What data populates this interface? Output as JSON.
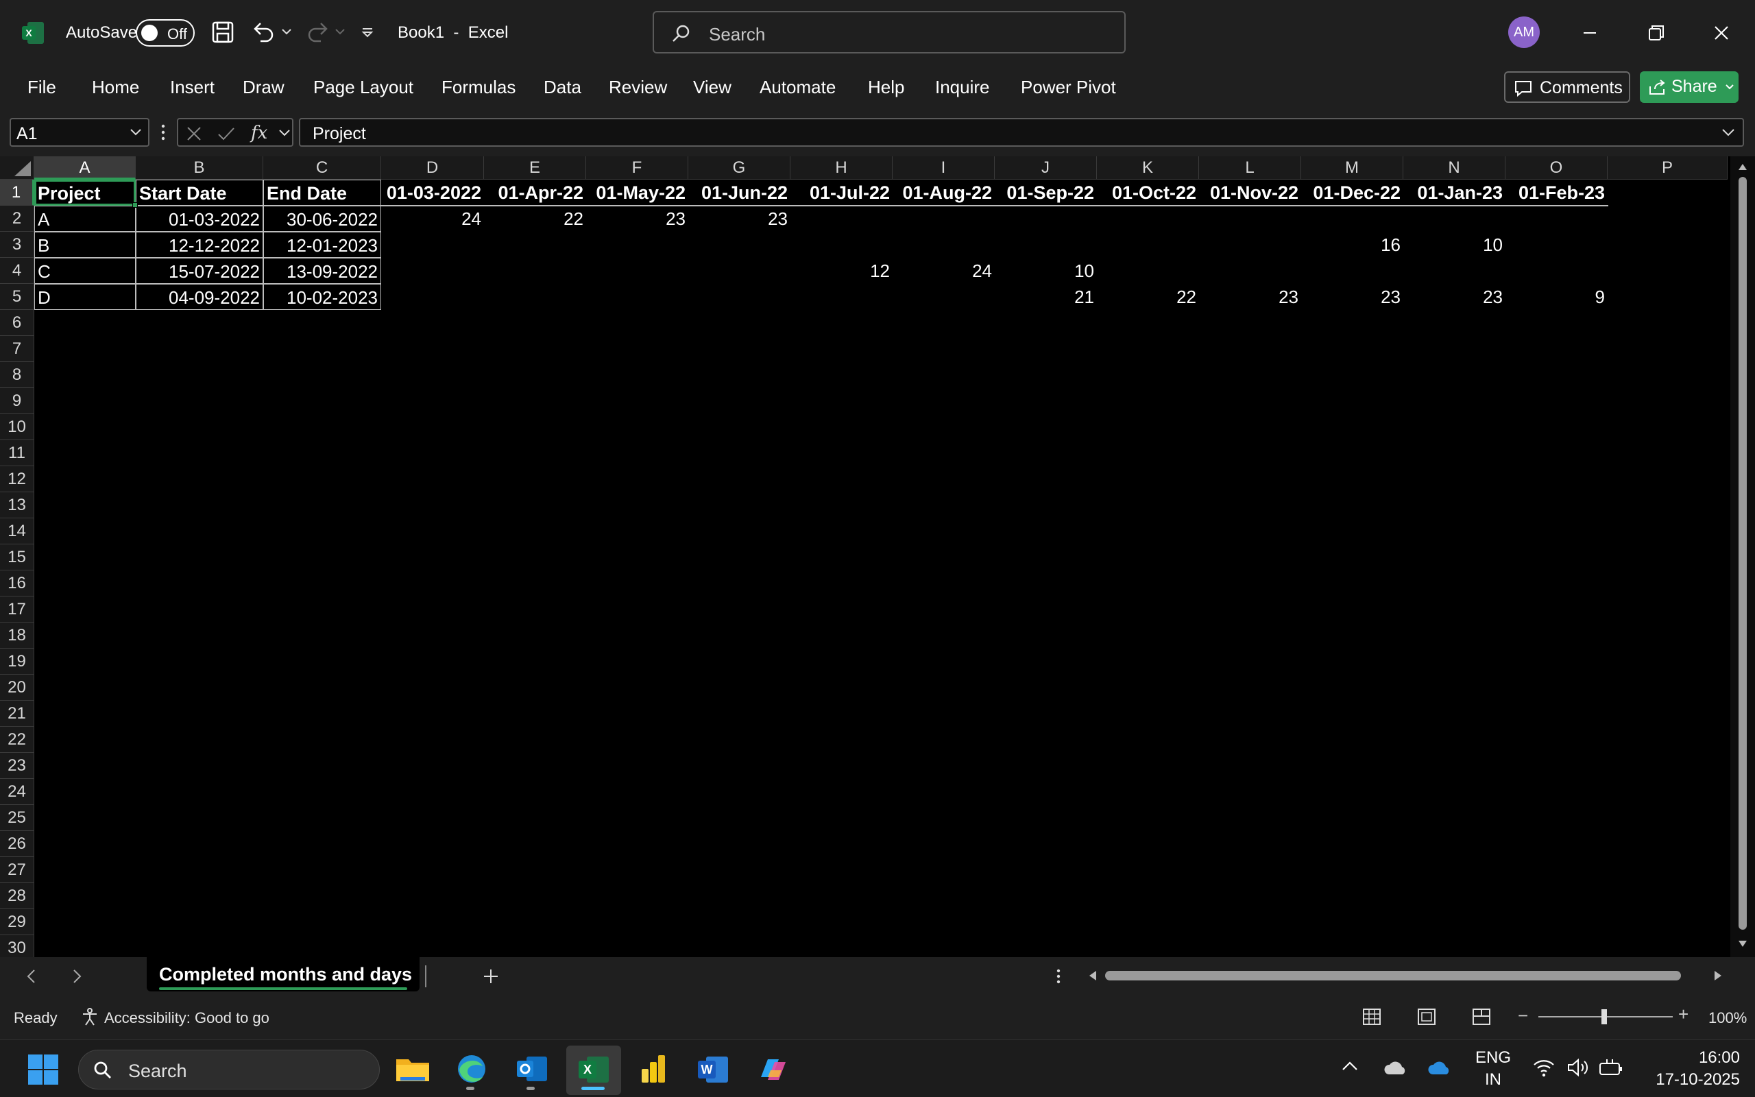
{
  "titlebar": {
    "autosave_label": "AutoSave",
    "autosave_state": "Off",
    "doc_title": "Book1  -  Excel",
    "search_placeholder": "Search",
    "avatar_initials": "AM"
  },
  "ribbon": {
    "tabs": [
      "File",
      "Home",
      "Insert",
      "Draw",
      "Page Layout",
      "Formulas",
      "Data",
      "Review",
      "View",
      "Automate",
      "Help",
      "Inquire",
      "Power Pivot"
    ],
    "comments_label": "Comments",
    "share_label": "Share"
  },
  "formula_bar": {
    "name_box": "A1",
    "formula": "Project"
  },
  "grid": {
    "columns": [
      "A",
      "B",
      "C",
      "D",
      "E",
      "F",
      "G",
      "H",
      "I",
      "J",
      "K",
      "L",
      "M",
      "N",
      "O",
      "P"
    ],
    "rows": [
      "1",
      "2",
      "3",
      "4",
      "5",
      "6",
      "7",
      "8",
      "9",
      "10",
      "11",
      "12",
      "13",
      "14",
      "15",
      "16",
      "17",
      "18",
      "19",
      "20",
      "21",
      "22",
      "23",
      "24",
      "25",
      "26",
      "27",
      "28",
      "29",
      "30"
    ],
    "header_row": [
      "Project",
      "Start Date",
      "End Date",
      "01-03-2022",
      "01-Apr-22",
      "01-May-22",
      "01-Jun-22",
      "01-Jul-22",
      "01-Aug-22",
      "01-Sep-22",
      "01-Oct-22",
      "01-Nov-22",
      "01-Dec-22",
      "01-Jan-23",
      "01-Feb-23"
    ],
    "data_rows": [
      [
        "A",
        "01-03-2022",
        "30-06-2022",
        "24",
        "22",
        "23",
        "23",
        "",
        "",
        "",
        "",
        "",
        "",
        "",
        ""
      ],
      [
        "B",
        "12-12-2022",
        "12-01-2023",
        "",
        "",
        "",
        "",
        "",
        "",
        "",
        "",
        "",
        "16",
        "10",
        ""
      ],
      [
        "C",
        "15-07-2022",
        "13-09-2022",
        "",
        "",
        "",
        "",
        "12",
        "24",
        "10",
        "",
        "",
        "",
        "",
        ""
      ],
      [
        "D",
        "04-09-2022",
        "10-02-2023",
        "",
        "",
        "",
        "",
        "",
        "",
        "21",
        "22",
        "23",
        "23",
        "23",
        "9"
      ]
    ]
  },
  "sheets": {
    "active_tab": "Completed months and days"
  },
  "status": {
    "ready": "Ready",
    "accessibility": "Accessibility: Good to go",
    "zoom": "100%"
  },
  "taskbar": {
    "search_placeholder": "Search",
    "lang_line1": "ENG",
    "lang_line2": "IN",
    "time": "16:00",
    "date": "17-10-2025"
  },
  "colors": {
    "accent_green": "#2e9b57",
    "excel_green": "#1d7044",
    "avatar_purple": "#8a63c9"
  }
}
